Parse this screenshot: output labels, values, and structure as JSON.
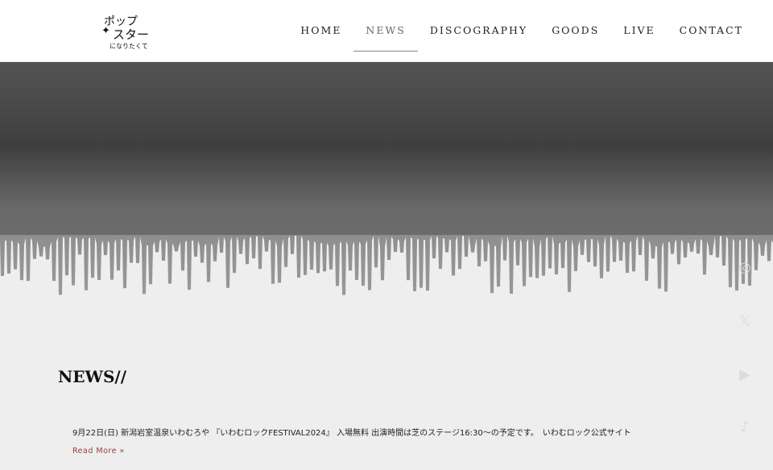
{
  "logo": {
    "line1": "ポップ",
    "line2": "スター",
    "line3": "になりたくて"
  },
  "nav": [
    {
      "label": "HOME"
    },
    {
      "label": "NEWS",
      "active": true
    },
    {
      "label": "DISCOGRAPHY"
    },
    {
      "label": "GOODS"
    },
    {
      "label": "LIVE"
    },
    {
      "label": "CONTACT"
    }
  ],
  "news": {
    "title": "NEWS//",
    "items": [
      {
        "text": "9月22日(日) 新潟岩室温泉いわむろや 『いわむロックFESTIVAL2024』 入場無料 出演時間は芝のステージ16:30～の予定です。　いわむロック公式サイト",
        "read_more": "Read More »"
      }
    ]
  },
  "social": [
    {
      "icon": "instagram-icon",
      "glyph": "◎"
    },
    {
      "icon": "x-icon",
      "glyph": "𝕏"
    },
    {
      "icon": "youtube-icon",
      "glyph": "▶"
    },
    {
      "icon": "tiktok-icon",
      "glyph": "♪"
    }
  ],
  "colors": {
    "accent": "#9a3b3b",
    "background": "#eeeeee"
  }
}
